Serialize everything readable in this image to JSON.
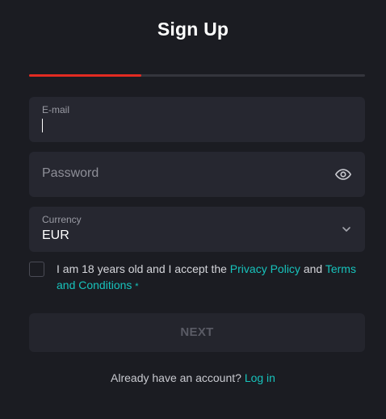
{
  "header": {
    "title": "Sign Up"
  },
  "progress": {
    "fraction": 0.333,
    "fill_color": "#e32b22",
    "track_color": "#34353d"
  },
  "form": {
    "email": {
      "label": "E-mail",
      "value": ""
    },
    "password": {
      "placeholder": "Password",
      "toggle_icon": "eye-icon"
    },
    "currency": {
      "label": "Currency",
      "value": "EUR",
      "dropdown_icon": "chevron-down-icon"
    },
    "consent": {
      "checked": false,
      "text_before": "I am 18 years old and I accept the ",
      "privacy_link": "Privacy Policy",
      "middle": " and ",
      "terms_link": "Terms and Conditions",
      "required_mark": "*"
    },
    "next_label": "NEXT"
  },
  "footer": {
    "prompt": "Already have an account?",
    "login_link": "Log in"
  },
  "colors": {
    "background": "#1b1c22",
    "field_bg": "#262730",
    "accent_link": "#17c3bc"
  }
}
